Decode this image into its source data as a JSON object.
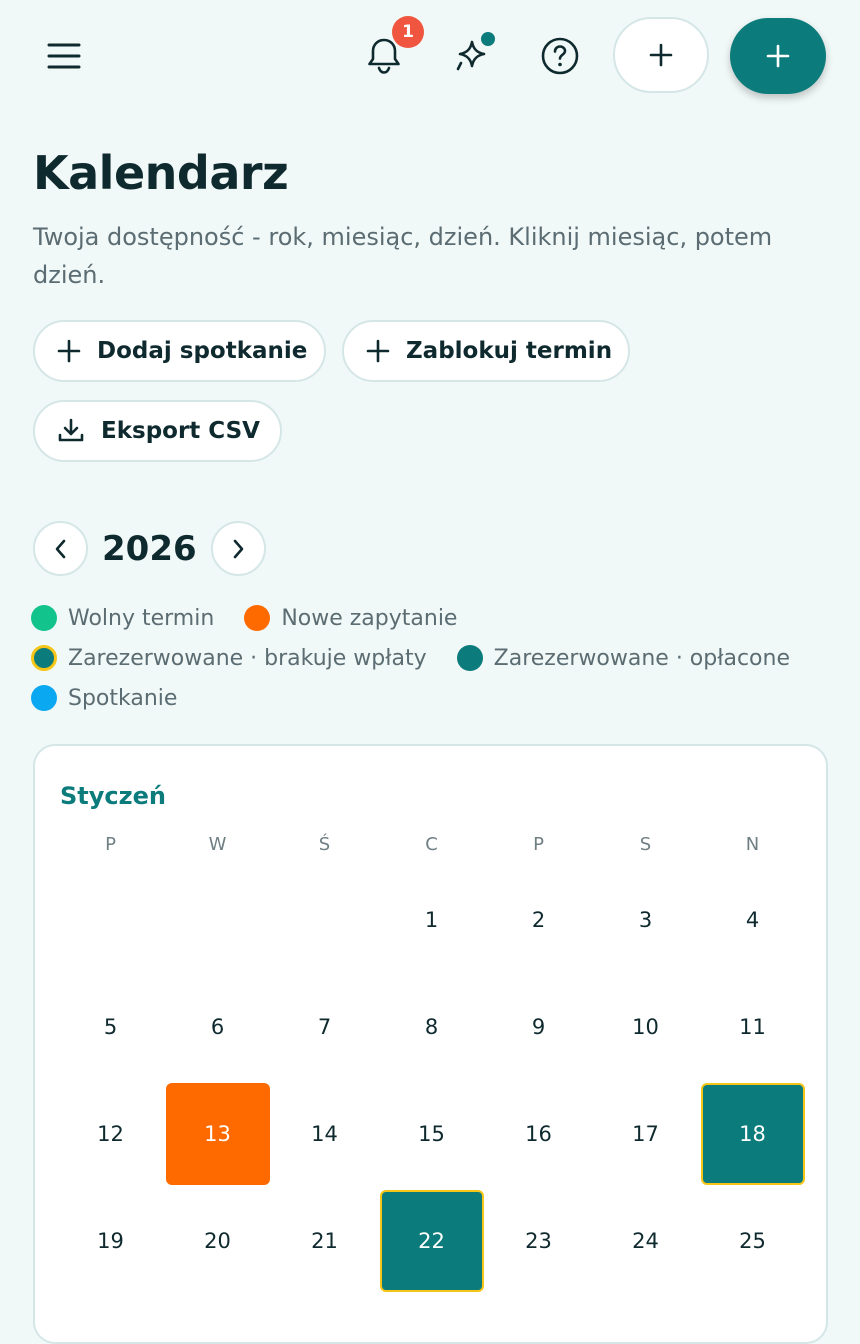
{
  "header": {
    "menu_icon": "hamburger-menu-icon",
    "notifications_icon": "bell-icon",
    "notifications_count": "1",
    "ai_icon": "sparkle-icon",
    "help_icon": "question-circle-icon",
    "add_icon": "plus-icon",
    "accent_color": "#0c7b7b",
    "badge_color": "#f0563f"
  },
  "page": {
    "title": "Kalendarz",
    "subtitle": "Twoja dostępność - rok, miesiąc, dzień. Kliknij miesiąc, potem dzień."
  },
  "actions": {
    "add_meeting": "Dodaj spotkanie",
    "block_term": "Zablokuj termin",
    "export_csv": "Eksport CSV"
  },
  "year_nav": {
    "year": "2026"
  },
  "legend": [
    {
      "label": "Wolny termin",
      "color": "#12c48b"
    },
    {
      "label": "Nowe zapytanie",
      "color": "#ff6a00"
    },
    {
      "label": "Zarezerwowane · brakuje wpłaty",
      "color": "#0c7b7b",
      "border": "#f5c518"
    },
    {
      "label": "Zarezerwowane · opłacone",
      "color": "#0c7b7b"
    },
    {
      "label": "Spotkanie",
      "color": "#0aa8f0"
    }
  ],
  "calendar": {
    "month": "Styczeń",
    "weekdays": [
      "P",
      "W",
      "Ś",
      "C",
      "P",
      "S",
      "N"
    ],
    "leading_blank_days": 3,
    "days": [
      {
        "n": "1",
        "status": ""
      },
      {
        "n": "2",
        "status": ""
      },
      {
        "n": "3",
        "status": ""
      },
      {
        "n": "4",
        "status": ""
      },
      {
        "n": "5",
        "status": ""
      },
      {
        "n": "6",
        "status": ""
      },
      {
        "n": "7",
        "status": ""
      },
      {
        "n": "8",
        "status": ""
      },
      {
        "n": "9",
        "status": ""
      },
      {
        "n": "10",
        "status": ""
      },
      {
        "n": "11",
        "status": ""
      },
      {
        "n": "12",
        "status": ""
      },
      {
        "n": "13",
        "status": "request"
      },
      {
        "n": "14",
        "status": ""
      },
      {
        "n": "15",
        "status": ""
      },
      {
        "n": "16",
        "status": ""
      },
      {
        "n": "17",
        "status": ""
      },
      {
        "n": "18",
        "status": "booked-unpaid"
      },
      {
        "n": "19",
        "status": ""
      },
      {
        "n": "20",
        "status": ""
      },
      {
        "n": "21",
        "status": ""
      },
      {
        "n": "22",
        "status": "booked-unpaid"
      },
      {
        "n": "23",
        "status": ""
      },
      {
        "n": "24",
        "status": ""
      },
      {
        "n": "25",
        "status": ""
      }
    ]
  }
}
